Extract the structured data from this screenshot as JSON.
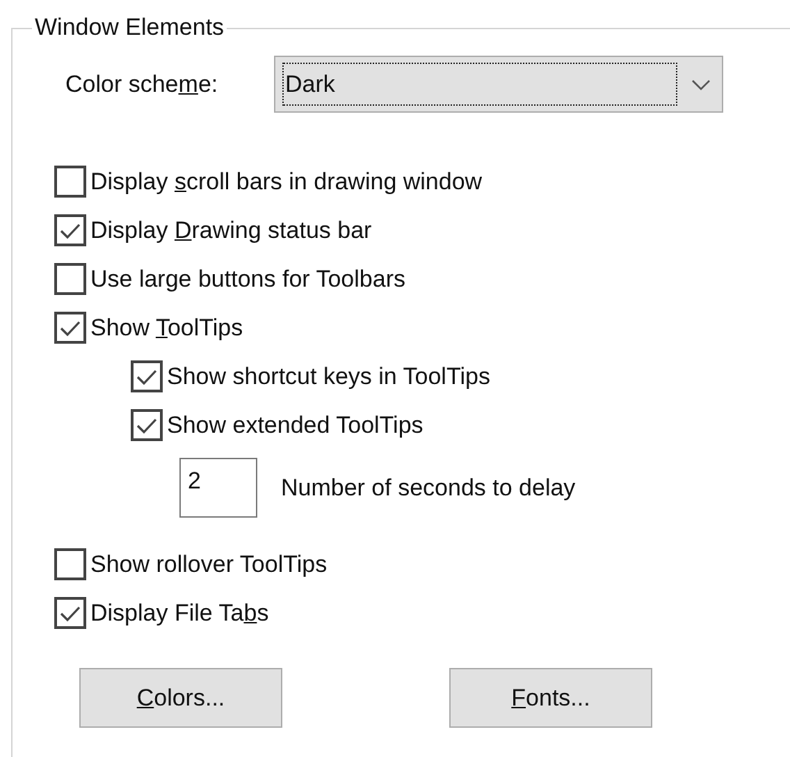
{
  "group": {
    "title": "Window Elements"
  },
  "color_scheme": {
    "label_parts": [
      "Color sche",
      "m",
      "e:"
    ],
    "value": "Dark"
  },
  "options": [
    {
      "kind": "checkbox",
      "label_parts": [
        "Display ",
        "s",
        "croll bars in drawing window"
      ],
      "checked": false
    },
    {
      "kind": "checkbox",
      "label_parts": [
        "Display ",
        "D",
        "rawing status bar"
      ],
      "checked": true
    },
    {
      "kind": "checkbox",
      "label_parts": [
        "Use large buttons for Toolbars"
      ],
      "checked": false
    },
    {
      "kind": "checkbox",
      "label_parts": [
        "Show ",
        "T",
        "oolTips"
      ],
      "checked": true,
      "children": [
        {
          "kind": "checkbox",
          "label_parts": [
            "Show shortcut keys in ToolTips"
          ],
          "checked": true
        },
        {
          "kind": "checkbox",
          "label_parts": [
            "Show extended ToolTips"
          ],
          "checked": true,
          "children": [
            {
              "kind": "number",
              "value": "2",
              "label_parts": [
                "Number of seconds to delay"
              ]
            }
          ]
        }
      ]
    },
    {
      "kind": "checkbox",
      "label_parts": [
        "Show rollover ToolTips"
      ],
      "checked": false
    },
    {
      "kind": "checkbox",
      "label_parts": [
        "Display File Ta",
        "b",
        "s"
      ],
      "checked": true
    }
  ],
  "buttons": [
    {
      "access_key": "C",
      "label_rest": "olors..."
    },
    {
      "access_key": "F",
      "label_rest": "onts..."
    }
  ]
}
